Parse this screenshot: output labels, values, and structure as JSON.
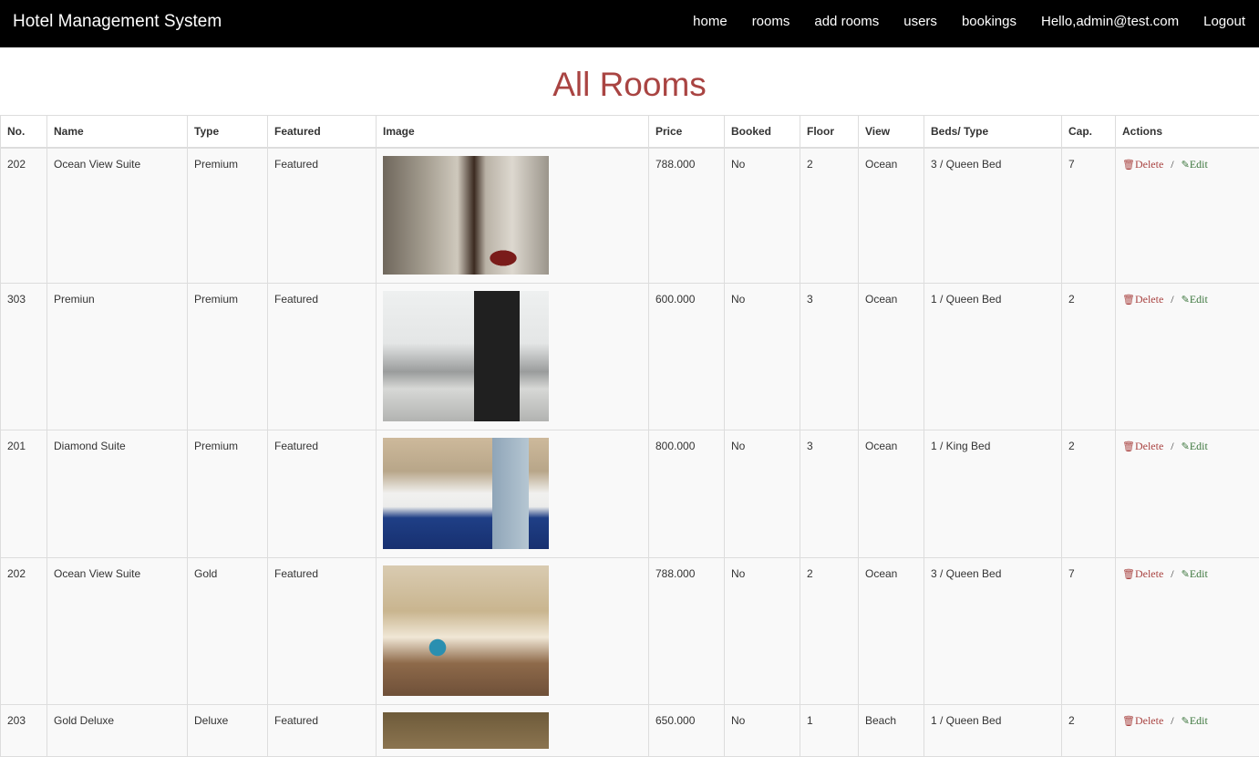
{
  "app": {
    "brand": "Hotel Management System",
    "nav": [
      "home",
      "rooms",
      "add rooms",
      "users",
      "bookings",
      "Hello,admin@test.com",
      "Logout"
    ]
  },
  "page": {
    "title": "All Rooms"
  },
  "table": {
    "headers": [
      "No.",
      "Name",
      "Type",
      "Featured",
      "Image",
      "Price",
      "Booked",
      "Floor",
      "View",
      "Beds/ Type",
      "Cap.",
      "Actions"
    ],
    "actions": {
      "delete": "Delete",
      "edit": "Edit",
      "separator": "/"
    },
    "rows": [
      {
        "no": "202",
        "name": "Ocean View Suite",
        "type": "Premium",
        "featured": "Featured",
        "image": "bathroom-photo",
        "price": "788.000",
        "booked": "No",
        "floor": "2",
        "view": "Ocean",
        "beds": "3 / Queen Bed",
        "cap": "7"
      },
      {
        "no": "303",
        "name": "Premiun",
        "type": "Premium",
        "featured": "Featured",
        "image": "living-room-photo",
        "price": "600.000",
        "booked": "No",
        "floor": "3",
        "view": "Ocean",
        "beds": "1 / Queen Bed",
        "cap": "2"
      },
      {
        "no": "201",
        "name": "Diamond Suite",
        "type": "Premium",
        "featured": "Featured",
        "image": "bedroom-photo",
        "price": "800.000",
        "booked": "No",
        "floor": "3",
        "view": "Ocean",
        "beds": "1 / King Bed",
        "cap": "2"
      },
      {
        "no": "202",
        "name": "Ocean View Suite",
        "type": "Gold",
        "featured": "Featured",
        "image": "lounge-photo",
        "price": "788.000",
        "booked": "No",
        "floor": "2",
        "view": "Ocean",
        "beds": "3 / Queen Bed",
        "cap": "7"
      },
      {
        "no": "203",
        "name": "Gold Deluxe",
        "type": "Deluxe",
        "featured": "Featured",
        "image": "room-photo",
        "price": "650.000",
        "booked": "No",
        "floor": "1",
        "view": "Beach",
        "beds": "1 / Queen Bed",
        "cap": "2"
      }
    ]
  },
  "icons": {
    "delete": "trash-icon",
    "edit": "pencil-icon"
  },
  "colors": {
    "navbar": "#000000",
    "title": "#a94442",
    "delete": "#a94442",
    "edit": "#3c763d"
  }
}
